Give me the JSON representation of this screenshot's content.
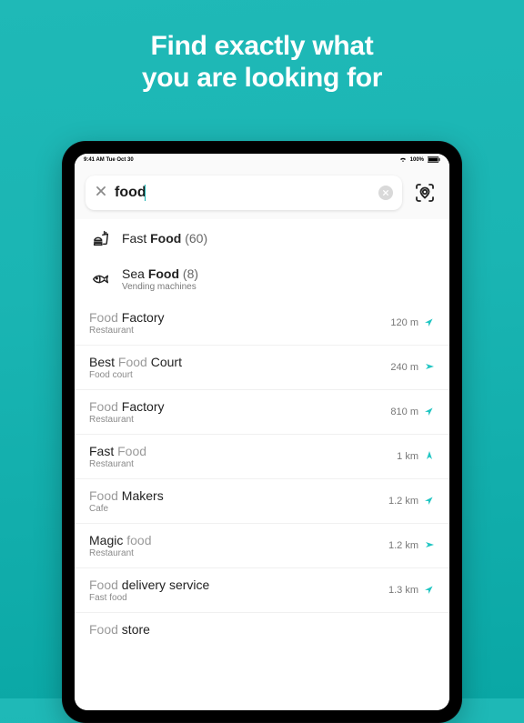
{
  "hero": {
    "line1": "Find exactly what",
    "line2": "you are looking for"
  },
  "statusbar": {
    "left": "9:41 AM   Tue Oct 30",
    "battery": "100%"
  },
  "search": {
    "value": "food"
  },
  "categories": [
    {
      "icon": "fastfood",
      "prefix": "Fast ",
      "match": "Food",
      "count": "(60)",
      "sub": ""
    },
    {
      "icon": "fish",
      "prefix": "Sea ",
      "match": "Food",
      "count": "(8)",
      "sub": "Vending machines"
    }
  ],
  "results": [
    {
      "pre": "",
      "match": "Food",
      "post": " Factory",
      "sub": "Restaurant",
      "dist": "120 m",
      "dir": "ne"
    },
    {
      "pre": "Best ",
      "match": "Food",
      "post": " Court",
      "sub": "Food court",
      "dist": "240 m",
      "dir": "e"
    },
    {
      "pre": "",
      "match": "Food",
      "post": " Factory",
      "sub": "Restaurant",
      "dist": "810 m",
      "dir": "ne"
    },
    {
      "pre": "Fast ",
      "match": "Food",
      "post": "",
      "sub": "Restaurant",
      "dist": "1 km",
      "dir": "n"
    },
    {
      "pre": "",
      "match": "Food",
      "post": " Makers",
      "sub": "Cafe",
      "dist": "1.2 km",
      "dir": "ne"
    },
    {
      "pre": "Magic ",
      "match": "food",
      "post": "",
      "sub": "Restaurant",
      "dist": "1.2 km",
      "dir": "e"
    },
    {
      "pre": "",
      "match": "Food",
      "post": " delivery service",
      "sub": "Fast food",
      "dist": "1.3 km",
      "dir": "ne"
    },
    {
      "pre": "",
      "match": "Food",
      "post": " store",
      "sub": "",
      "dist": "",
      "dir": ""
    }
  ]
}
